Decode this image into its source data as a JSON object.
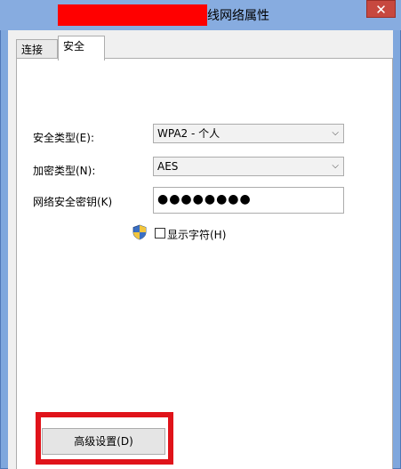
{
  "window": {
    "title": "线网络属性",
    "close_label": "✕"
  },
  "tabs": [
    {
      "label": "连接"
    },
    {
      "label": "安全"
    }
  ],
  "security": {
    "security_type_label": "安全类型(E):",
    "security_type_value": "WPA2 - 个人",
    "encryption_type_label": "加密类型(N):",
    "encryption_type_value": "AES",
    "network_key_label": "网络安全密钥(K)",
    "network_key_value": "●●●●●●●●",
    "show_chars_label": "显示字符(H)",
    "show_chars_checked": false
  },
  "advanced_button_label": "高级设置(D)",
  "colors": {
    "redaction": "#ff0000",
    "highlight": "#e0131a",
    "close_button": "#c7483f"
  }
}
